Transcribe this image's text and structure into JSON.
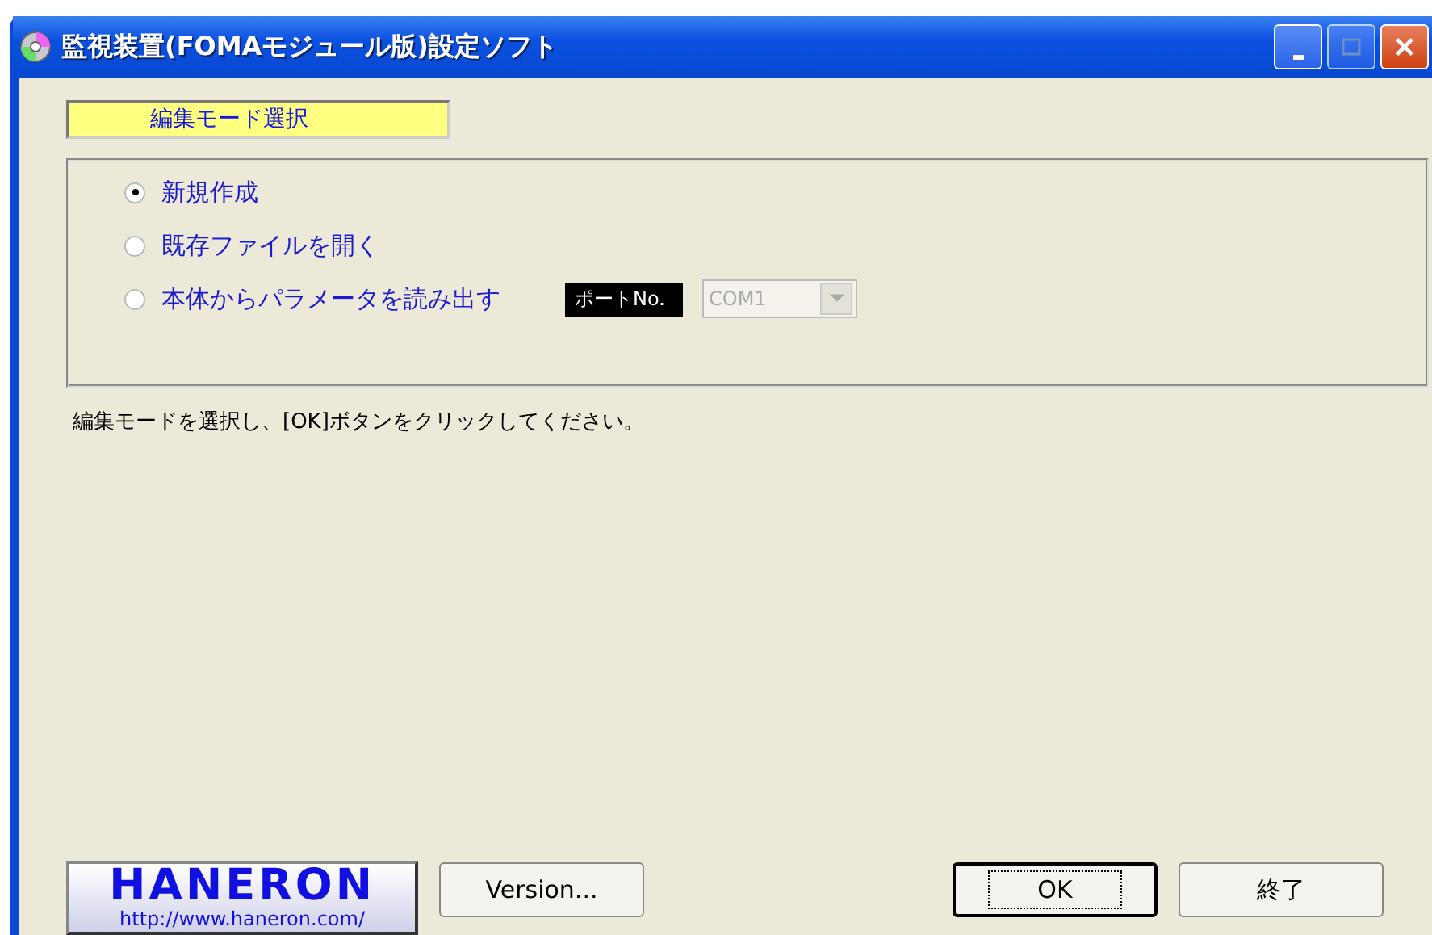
{
  "window": {
    "title": "監視装置(FOMAモジュール版)設定ソフト"
  },
  "mode_label": "編集モード選択",
  "options": [
    {
      "label": "新規作成",
      "selected": true
    },
    {
      "label": "既存ファイルを開く",
      "selected": false
    },
    {
      "label": "本体からパラメータを読み出す",
      "selected": false
    }
  ],
  "port": {
    "label": "ポートNo.",
    "value": "COM1",
    "disabled": true
  },
  "instruction": "編集モードを選択し、[OK]ボタンをクリックしてください。",
  "logo": {
    "name": "HANERON",
    "url": "http://www.haneron.com/"
  },
  "buttons": [
    {
      "label": "Version...",
      "default": false
    },
    {
      "label": "OK",
      "default": true
    },
    {
      "label": "終了",
      "default": false
    }
  ]
}
